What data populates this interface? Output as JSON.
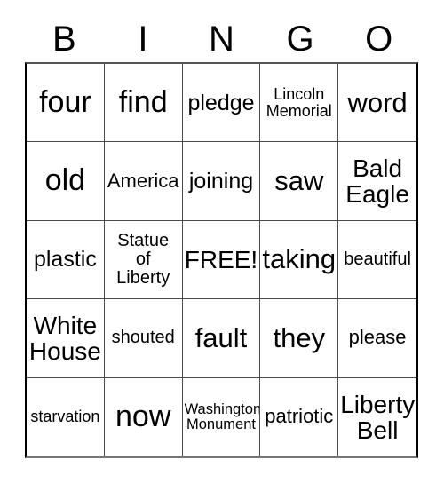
{
  "card": {
    "title": "BINGO Card",
    "header_letters": [
      "B",
      "I",
      "N",
      "G",
      "O"
    ],
    "free_space_label": "FREE!",
    "colors": {
      "background": "#ffffff",
      "text": "#000000",
      "grid_line": "#4a4a4a",
      "grid_border": "#000000"
    },
    "rows": [
      [
        {
          "text": "four",
          "size": "s-xxl",
          "lines": 1
        },
        {
          "text": "find",
          "size": "s-xxl",
          "lines": 1
        },
        {
          "text": "pledge",
          "size": "s-md",
          "lines": 1
        },
        {
          "text": "Lincoln\nMemorial",
          "size": "s-xxs",
          "lines": 2
        },
        {
          "text": "word",
          "size": "s-xl",
          "lines": 1
        }
      ],
      [
        {
          "text": "old",
          "size": "s-xxl",
          "lines": 1
        },
        {
          "text": "America",
          "size": "s-sm",
          "lines": 1
        },
        {
          "text": "joining",
          "size": "s-md",
          "lines": 1
        },
        {
          "text": "saw",
          "size": "s-xl",
          "lines": 1
        },
        {
          "text": "Bald\nEagle",
          "size": "s-lg",
          "lines": 2
        }
      ],
      [
        {
          "text": "plastic",
          "size": "s-md",
          "lines": 1
        },
        {
          "text": "Statue\nof\nLiberty",
          "size": "s-xs",
          "lines": 3
        },
        {
          "text": "FREE!",
          "size": "s-lg",
          "lines": 1
        },
        {
          "text": "taking",
          "size": "s-xl",
          "lines": 1
        },
        {
          "text": "beautiful",
          "size": "s-xs",
          "lines": 1
        }
      ],
      [
        {
          "text": "White\nHouse",
          "size": "s-lg",
          "lines": 2
        },
        {
          "text": "shouted",
          "size": "s-xs",
          "lines": 1
        },
        {
          "text": "fault",
          "size": "s-xl",
          "lines": 1
        },
        {
          "text": "they",
          "size": "s-xl",
          "lines": 1
        },
        {
          "text": "please",
          "size": "s-sm",
          "lines": 1
        }
      ],
      [
        {
          "text": "starvation",
          "size": "s-xxs",
          "lines": 1
        },
        {
          "text": "now",
          "size": "s-xxl",
          "lines": 1
        },
        {
          "text": "Washington\nMonument",
          "size": "s-tiny",
          "lines": 2
        },
        {
          "text": "patriotic",
          "size": "s-sm",
          "lines": 1
        },
        {
          "text": "Liberty\nBell",
          "size": "s-lg",
          "lines": 2
        }
      ]
    ]
  }
}
